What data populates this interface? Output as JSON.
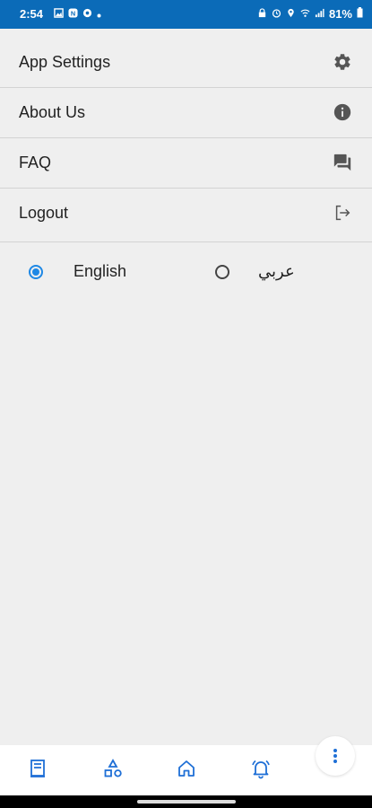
{
  "status_bar": {
    "time": "2:54",
    "battery": "81%"
  },
  "menu": {
    "items": [
      {
        "label": "App Settings",
        "icon": "gear-icon"
      },
      {
        "label": "About Us",
        "icon": "info-icon"
      },
      {
        "label": "FAQ",
        "icon": "chat-icon"
      },
      {
        "label": "Logout",
        "icon": "logout-icon"
      }
    ]
  },
  "language": {
    "options": [
      {
        "label": "English",
        "selected": true
      },
      {
        "label": "عربي",
        "selected": false
      }
    ]
  },
  "bottom_nav": {
    "items": [
      "book-icon",
      "shapes-icon",
      "home-icon",
      "bell-icon",
      "more-vert-icon"
    ]
  },
  "colors": {
    "status_bar": "#0b6bb8",
    "accent": "#1e88e5",
    "nav_icon": "#1e6fd6",
    "background": "#efefef"
  }
}
